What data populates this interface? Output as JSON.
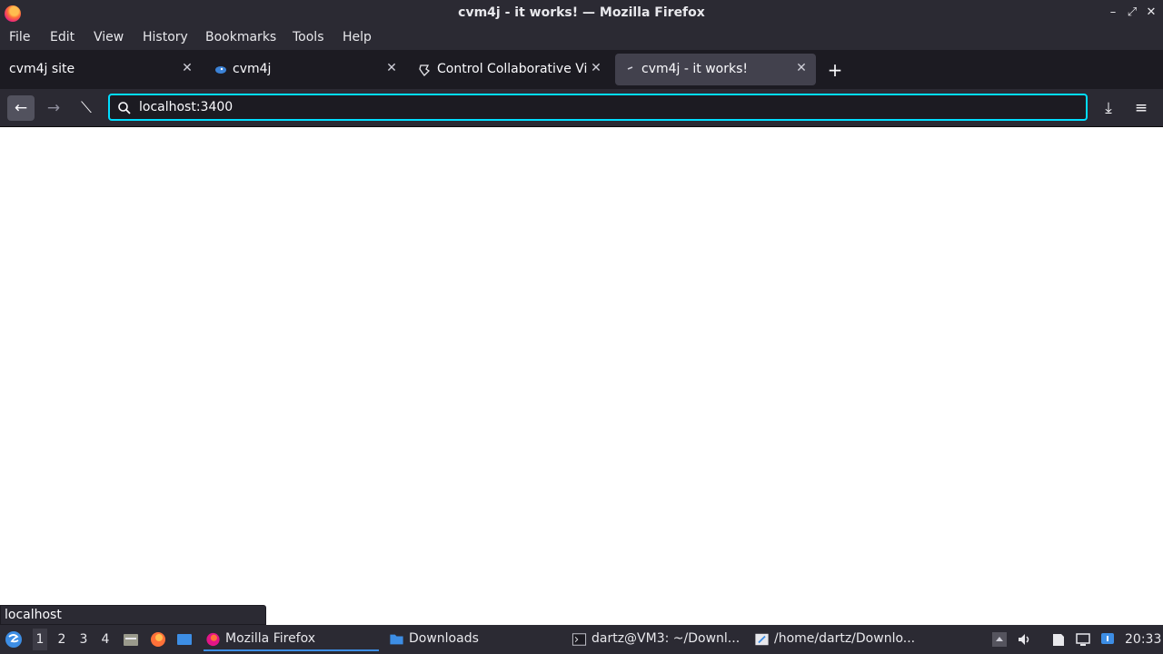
{
  "window": {
    "title": "cvm4j - it works! — Mozilla Firefox",
    "controls": {
      "minimize": "–",
      "restore": "⤢",
      "close": "✕"
    }
  },
  "menu": [
    "File",
    "Edit",
    "View",
    "History",
    "Bookmarks",
    "Tools",
    "Help"
  ],
  "tabs": [
    {
      "label": "cvm4j site"
    },
    {
      "label": "cvm4j"
    },
    {
      "label": "Control Collaborative Virt"
    },
    {
      "label": "cvm4j - it works!",
      "active": true
    }
  ],
  "tab_close": "✕",
  "new_tab": "+",
  "nav": {
    "back": "←",
    "forward": "→",
    "reload": "⟍",
    "url": "localhost:3400",
    "downloads": "⤓",
    "menu": "≡"
  },
  "status": {
    "link": "localhost"
  },
  "taskbar": {
    "workspaces": [
      "1",
      "2",
      "3",
      "4"
    ],
    "tasks": [
      {
        "label": "Mozilla Firefox"
      },
      {
        "label": "Downloads"
      },
      {
        "label": "dartz@VM3: ~/Downl..."
      },
      {
        "label": "/home/dartz/Downlo..."
      }
    ],
    "clock": "20:33"
  },
  "colors": {
    "chrome": "#2b2a33",
    "tabstrip": "#1c1b22",
    "focus_ring": "#00ddff",
    "accent": "#3d8ee5"
  }
}
